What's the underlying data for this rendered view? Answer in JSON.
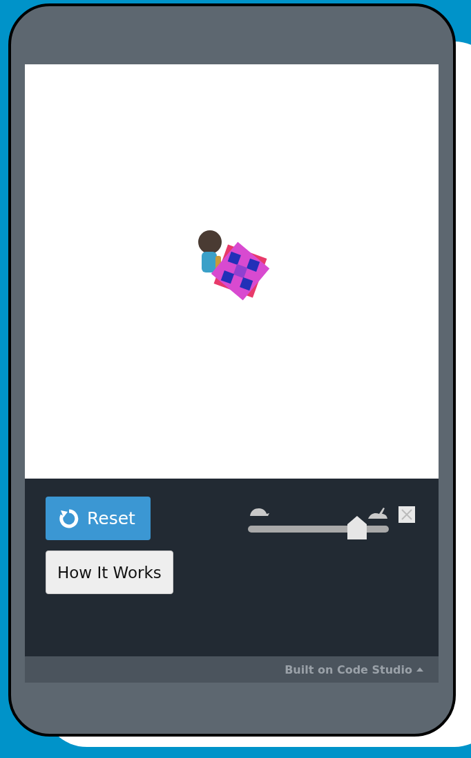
{
  "controls": {
    "reset_button": "Reset",
    "how_it_works_button": "How It Works"
  },
  "speed_slider": {
    "level": 0.82
  },
  "footer": {
    "text": "Built on Code Studio"
  }
}
